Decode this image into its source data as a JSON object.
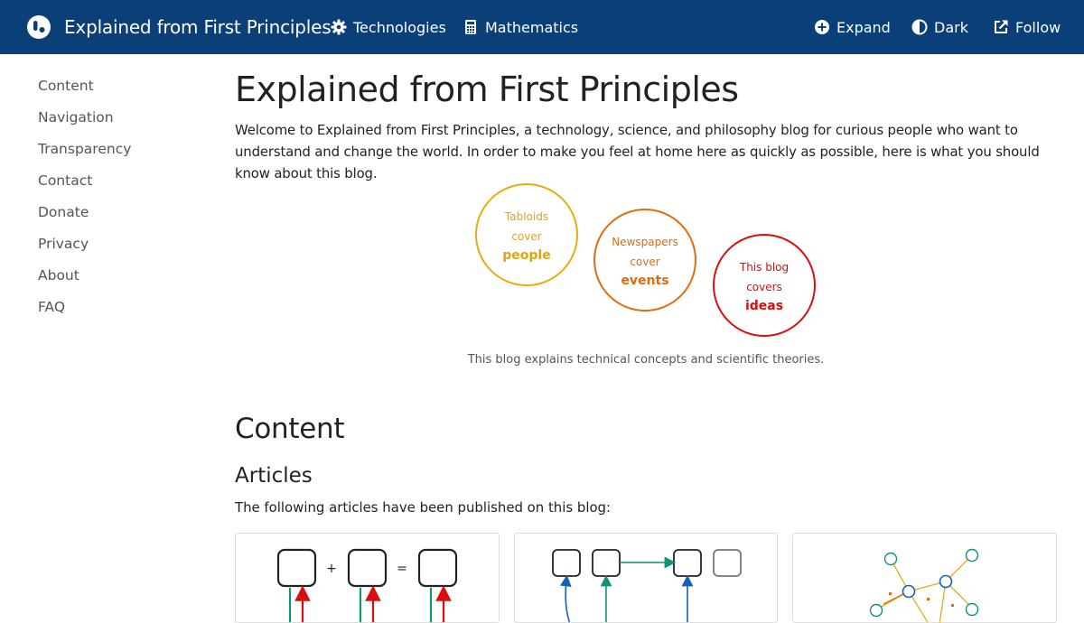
{
  "header": {
    "brand_title": "Explained from First Principles",
    "nav_left": [
      {
        "label": "Technologies",
        "icon": "gear-icon"
      },
      {
        "label": "Mathematics",
        "icon": "calculator-icon"
      }
    ],
    "nav_right": [
      {
        "label": "Expand",
        "icon": "plus-circle-icon"
      },
      {
        "label": "Dark",
        "icon": "contrast-icon"
      },
      {
        "label": "Follow",
        "icon": "external-link-icon"
      }
    ],
    "background_color": "#0b3f78"
  },
  "sidebar": {
    "items": [
      {
        "label": "Content"
      },
      {
        "label": "Navigation"
      },
      {
        "label": "Transparency"
      },
      {
        "label": "Contact"
      },
      {
        "label": "Donate"
      },
      {
        "label": "Privacy"
      },
      {
        "label": "About"
      },
      {
        "label": "FAQ"
      }
    ]
  },
  "main": {
    "title": "Explained from First Principles",
    "intro": "Welcome to Explained from First Principles, a technology, science, and philosophy blog for curious people who want to understand and change the world. In order to make you feel at home here as quickly as possible, here is what you should know about this blog.",
    "circles": [
      {
        "line1": "Tabloids",
        "line2": "cover",
        "strong": "people",
        "color": "#e6ac12"
      },
      {
        "line1": "Newspapers",
        "line2": "cover",
        "strong": "events",
        "color": "#e36c10"
      },
      {
        "line1": "This blog",
        "line2": "covers",
        "strong": "ideas",
        "color": "#d90f0f"
      }
    ],
    "caption": "This blog explains technical concepts and scientific theories.",
    "content_heading": "Content",
    "articles_heading": "Articles",
    "articles_intro": "The following articles have been published on this blog:",
    "cards": [
      {
        "plus": "+",
        "equals": "="
      },
      {},
      {}
    ]
  }
}
